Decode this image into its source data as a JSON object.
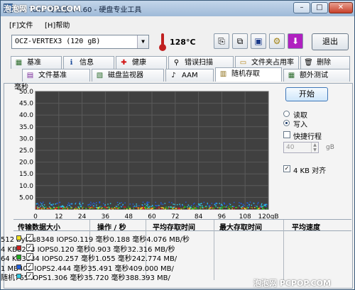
{
  "watermark": {
    "top": "泡泡网 PCPOP.COM",
    "bottom": "泡泡网 PCPOP.COM"
  },
  "title": "HD Tune 专业版 v4.60 - 硬盘专业工具",
  "window_buttons": {
    "minimize": "–",
    "maximize": "□",
    "close": "✕"
  },
  "menu": [
    "[F]文件",
    "[H]帮助"
  ],
  "toolbar": {
    "drive": "OCZ-VERTEX3  (120 gB)",
    "temperature": "128°C",
    "exit_label": "退出",
    "buttons": [
      {
        "name": "copy-info-icon",
        "glyph": "⎘"
      },
      {
        "name": "copy-screenshot-icon",
        "glyph": "⧉"
      },
      {
        "name": "save-icon",
        "glyph": "▣"
      },
      {
        "name": "options-icon",
        "glyph": "⚙"
      },
      {
        "name": "download-icon",
        "glyph": "⬇"
      }
    ]
  },
  "tabs_row1": [
    {
      "label": "基准",
      "icon": "▦"
    },
    {
      "label": "信息",
      "icon": "ℹ"
    },
    {
      "label": "健康",
      "icon": "✚"
    },
    {
      "label": "错误扫描",
      "icon": "⚲"
    },
    {
      "label": "文件夹占用率",
      "icon": "▭"
    },
    {
      "label": "删除",
      "icon": "🗑"
    }
  ],
  "tabs_row2": [
    {
      "label": "文件基准",
      "icon": "▤"
    },
    {
      "label": "磁盘监视器",
      "icon": "▧"
    },
    {
      "label": "AAM",
      "icon": "♪"
    },
    {
      "label": "随机存取",
      "icon": "▥"
    },
    {
      "label": "额外测试",
      "icon": "▦"
    }
  ],
  "controls": {
    "start": "开始",
    "read": "读取",
    "write": "写入",
    "mode_selected": "write",
    "short_stroke": "快捷行程",
    "short_stroke_checked": false,
    "short_stroke_value": "40",
    "short_stroke_unit": "gB",
    "align_4kb": "4 KB 对齐",
    "align_4kb_checked": true
  },
  "chart_data": {
    "type": "scatter",
    "ylabel": "毫秒",
    "xlabel": "",
    "ylim": [
      0,
      50
    ],
    "y_ticks": [
      "50.0",
      "45.0",
      "40.0",
      "35.0",
      "30.0",
      "25.0",
      "20.0",
      "15.0",
      "10.0",
      "5.00"
    ],
    "xlim": [
      0,
      120
    ],
    "x_ticks": [
      "0",
      "12",
      "24",
      "36",
      "48",
      "60",
      "72",
      "84",
      "96",
      "108",
      "120gB"
    ],
    "grid": true,
    "background": "#404040",
    "series": [
      {
        "name": "512 bytes",
        "color": "#f0e020",
        "band": [
          0.0,
          0.6
        ]
      },
      {
        "name": "4 KB",
        "color": "#d02020",
        "band": [
          0.0,
          0.9
        ]
      },
      {
        "name": "64 KB",
        "color": "#20b020",
        "band": [
          0.0,
          1.1
        ]
      },
      {
        "name": "1 MB",
        "color": "#2060e0",
        "band": [
          1.0,
          3.0
        ]
      },
      {
        "name": "随机",
        "color": "#30c8e0",
        "band": [
          0.5,
          2.5
        ]
      }
    ]
  },
  "results": {
    "headers": [
      "传输数据大小",
      "操作 / 秒",
      "平均存取时间",
      "最大存取时间",
      "平均速度"
    ],
    "rows": [
      {
        "label": "512 bytes",
        "color": "#f0e020",
        "ops": "8348 IOPS",
        "avg": "0.119 毫秒",
        "max": "0.188 毫秒",
        "speed": "4.076 MB/秒"
      },
      {
        "label": "4 KB",
        "color": "#d02020",
        "ops": "8273 IOPS",
        "avg": "0.120 毫秒",
        "max": "0.903 毫秒",
        "speed": "32.316 MB/秒"
      },
      {
        "label": "64 KB",
        "color": "#20b020",
        "ops": "3884 IOPS",
        "avg": "0.257 毫秒",
        "max": "1.055 毫秒",
        "speed": "242.774 MB/"
      },
      {
        "label": "1 MB",
        "color": "#2060e0",
        "ops": "409 IOPS",
        "avg": "2.444 毫秒",
        "max": "35.491 毫秒",
        "speed": "409.000 MB/"
      },
      {
        "label": "随机",
        "color": "#30c8e0",
        "ops": "765 IOPS",
        "avg": "1.306 毫秒",
        "max": "35.720 毫秒",
        "speed": "388.393 MB/"
      }
    ]
  }
}
